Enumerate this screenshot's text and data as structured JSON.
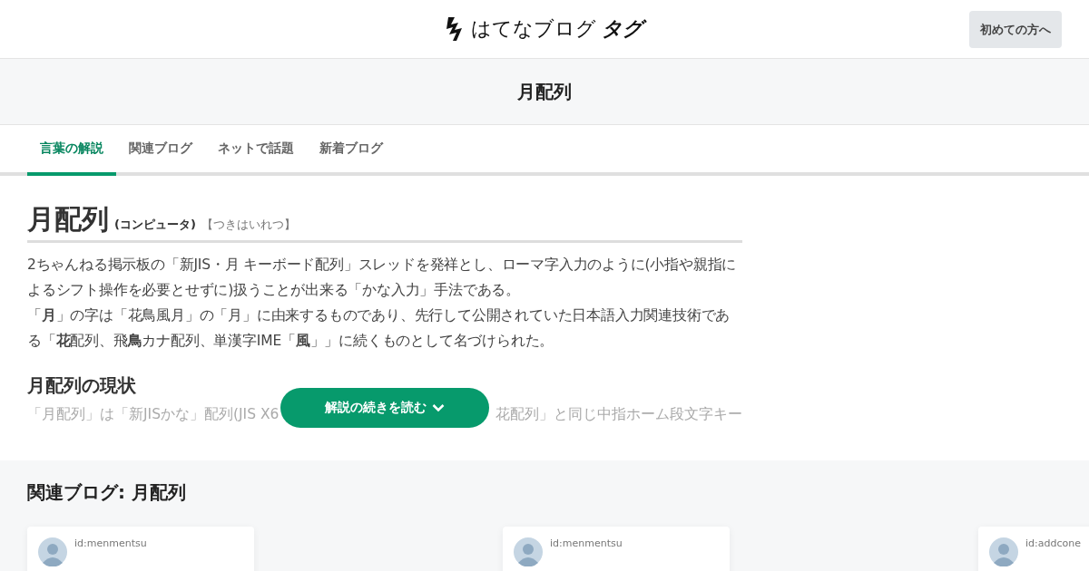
{
  "header": {
    "logo": {
      "brand": "はてなブログ",
      "suffix": "タグ"
    },
    "guide_button": "初めての方へ"
  },
  "page_title": "月配列",
  "tabs": [
    {
      "label": "言葉の解説",
      "selected": true
    },
    {
      "label": "関連ブログ",
      "selected": false
    },
    {
      "label": "ネットで話題",
      "selected": false
    },
    {
      "label": "新着ブログ",
      "selected": false
    }
  ],
  "article": {
    "title": "月配列",
    "category": "(コンピュータ)",
    "reading": "【つきはいれつ】",
    "paragraphs": [
      "2ちゃんねる掲示板の「新JIS・月 キーボード配列」スレッドを発祥とし、ローマ字入力のように(小指や親指によるシフト操作を必要とせずに)扱うことが出来る「かな入力」手法である。",
      "「**月**」の字は「花鳥風月」の「月」に由来するものであり、先行して公開されていた日本語入力関連技術である「**花**配列、飛**鳥**カナ配列、単漢字IME「**風**」」に続くものとして名づけられた。"
    ],
    "section_title": "月配列の現状",
    "faded_text": [
      "「月配列」は「新JISかな」配列(JIS X6",
      "花配列」と同じ中指ホーム段文字キー"
    ],
    "read_more": "解説の続きを読む"
  },
  "related": {
    "title": "関連ブログ: 月配列",
    "cards": [
      {
        "author": "id:menmentsu"
      },
      {
        "author": "id:menmentsu"
      },
      {
        "author": "id:addcone"
      }
    ]
  }
}
